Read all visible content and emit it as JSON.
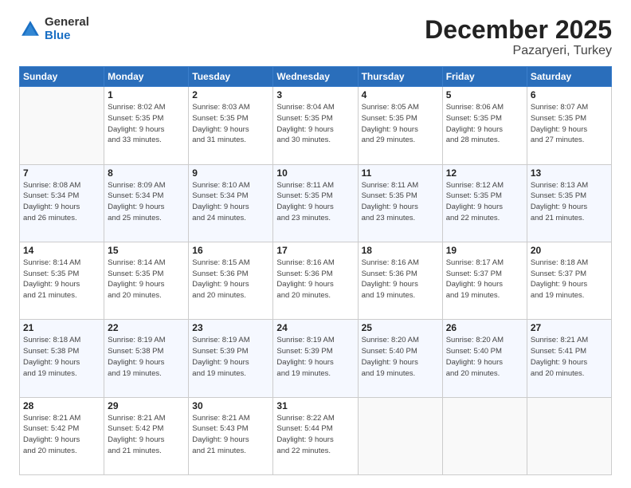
{
  "header": {
    "logo_general": "General",
    "logo_blue": "Blue",
    "month": "December 2025",
    "location": "Pazaryeri, Turkey"
  },
  "days_of_week": [
    "Sunday",
    "Monday",
    "Tuesday",
    "Wednesday",
    "Thursday",
    "Friday",
    "Saturday"
  ],
  "weeks": [
    [
      {
        "day": "",
        "info": ""
      },
      {
        "day": "1",
        "info": "Sunrise: 8:02 AM\nSunset: 5:35 PM\nDaylight: 9 hours\nand 33 minutes."
      },
      {
        "day": "2",
        "info": "Sunrise: 8:03 AM\nSunset: 5:35 PM\nDaylight: 9 hours\nand 31 minutes."
      },
      {
        "day": "3",
        "info": "Sunrise: 8:04 AM\nSunset: 5:35 PM\nDaylight: 9 hours\nand 30 minutes."
      },
      {
        "day": "4",
        "info": "Sunrise: 8:05 AM\nSunset: 5:35 PM\nDaylight: 9 hours\nand 29 minutes."
      },
      {
        "day": "5",
        "info": "Sunrise: 8:06 AM\nSunset: 5:35 PM\nDaylight: 9 hours\nand 28 minutes."
      },
      {
        "day": "6",
        "info": "Sunrise: 8:07 AM\nSunset: 5:35 PM\nDaylight: 9 hours\nand 27 minutes."
      }
    ],
    [
      {
        "day": "7",
        "info": "Sunrise: 8:08 AM\nSunset: 5:34 PM\nDaylight: 9 hours\nand 26 minutes."
      },
      {
        "day": "8",
        "info": "Sunrise: 8:09 AM\nSunset: 5:34 PM\nDaylight: 9 hours\nand 25 minutes."
      },
      {
        "day": "9",
        "info": "Sunrise: 8:10 AM\nSunset: 5:34 PM\nDaylight: 9 hours\nand 24 minutes."
      },
      {
        "day": "10",
        "info": "Sunrise: 8:11 AM\nSunset: 5:35 PM\nDaylight: 9 hours\nand 23 minutes."
      },
      {
        "day": "11",
        "info": "Sunrise: 8:11 AM\nSunset: 5:35 PM\nDaylight: 9 hours\nand 23 minutes."
      },
      {
        "day": "12",
        "info": "Sunrise: 8:12 AM\nSunset: 5:35 PM\nDaylight: 9 hours\nand 22 minutes."
      },
      {
        "day": "13",
        "info": "Sunrise: 8:13 AM\nSunset: 5:35 PM\nDaylight: 9 hours\nand 21 minutes."
      }
    ],
    [
      {
        "day": "14",
        "info": "Sunrise: 8:14 AM\nSunset: 5:35 PM\nDaylight: 9 hours\nand 21 minutes."
      },
      {
        "day": "15",
        "info": "Sunrise: 8:14 AM\nSunset: 5:35 PM\nDaylight: 9 hours\nand 20 minutes."
      },
      {
        "day": "16",
        "info": "Sunrise: 8:15 AM\nSunset: 5:36 PM\nDaylight: 9 hours\nand 20 minutes."
      },
      {
        "day": "17",
        "info": "Sunrise: 8:16 AM\nSunset: 5:36 PM\nDaylight: 9 hours\nand 20 minutes."
      },
      {
        "day": "18",
        "info": "Sunrise: 8:16 AM\nSunset: 5:36 PM\nDaylight: 9 hours\nand 19 minutes."
      },
      {
        "day": "19",
        "info": "Sunrise: 8:17 AM\nSunset: 5:37 PM\nDaylight: 9 hours\nand 19 minutes."
      },
      {
        "day": "20",
        "info": "Sunrise: 8:18 AM\nSunset: 5:37 PM\nDaylight: 9 hours\nand 19 minutes."
      }
    ],
    [
      {
        "day": "21",
        "info": "Sunrise: 8:18 AM\nSunset: 5:38 PM\nDaylight: 9 hours\nand 19 minutes."
      },
      {
        "day": "22",
        "info": "Sunrise: 8:19 AM\nSunset: 5:38 PM\nDaylight: 9 hours\nand 19 minutes."
      },
      {
        "day": "23",
        "info": "Sunrise: 8:19 AM\nSunset: 5:39 PM\nDaylight: 9 hours\nand 19 minutes."
      },
      {
        "day": "24",
        "info": "Sunrise: 8:19 AM\nSunset: 5:39 PM\nDaylight: 9 hours\nand 19 minutes."
      },
      {
        "day": "25",
        "info": "Sunrise: 8:20 AM\nSunset: 5:40 PM\nDaylight: 9 hours\nand 19 minutes."
      },
      {
        "day": "26",
        "info": "Sunrise: 8:20 AM\nSunset: 5:40 PM\nDaylight: 9 hours\nand 20 minutes."
      },
      {
        "day": "27",
        "info": "Sunrise: 8:21 AM\nSunset: 5:41 PM\nDaylight: 9 hours\nand 20 minutes."
      }
    ],
    [
      {
        "day": "28",
        "info": "Sunrise: 8:21 AM\nSunset: 5:42 PM\nDaylight: 9 hours\nand 20 minutes."
      },
      {
        "day": "29",
        "info": "Sunrise: 8:21 AM\nSunset: 5:42 PM\nDaylight: 9 hours\nand 21 minutes."
      },
      {
        "day": "30",
        "info": "Sunrise: 8:21 AM\nSunset: 5:43 PM\nDaylight: 9 hours\nand 21 minutes."
      },
      {
        "day": "31",
        "info": "Sunrise: 8:22 AM\nSunset: 5:44 PM\nDaylight: 9 hours\nand 22 minutes."
      },
      {
        "day": "",
        "info": ""
      },
      {
        "day": "",
        "info": ""
      },
      {
        "day": "",
        "info": ""
      }
    ]
  ]
}
